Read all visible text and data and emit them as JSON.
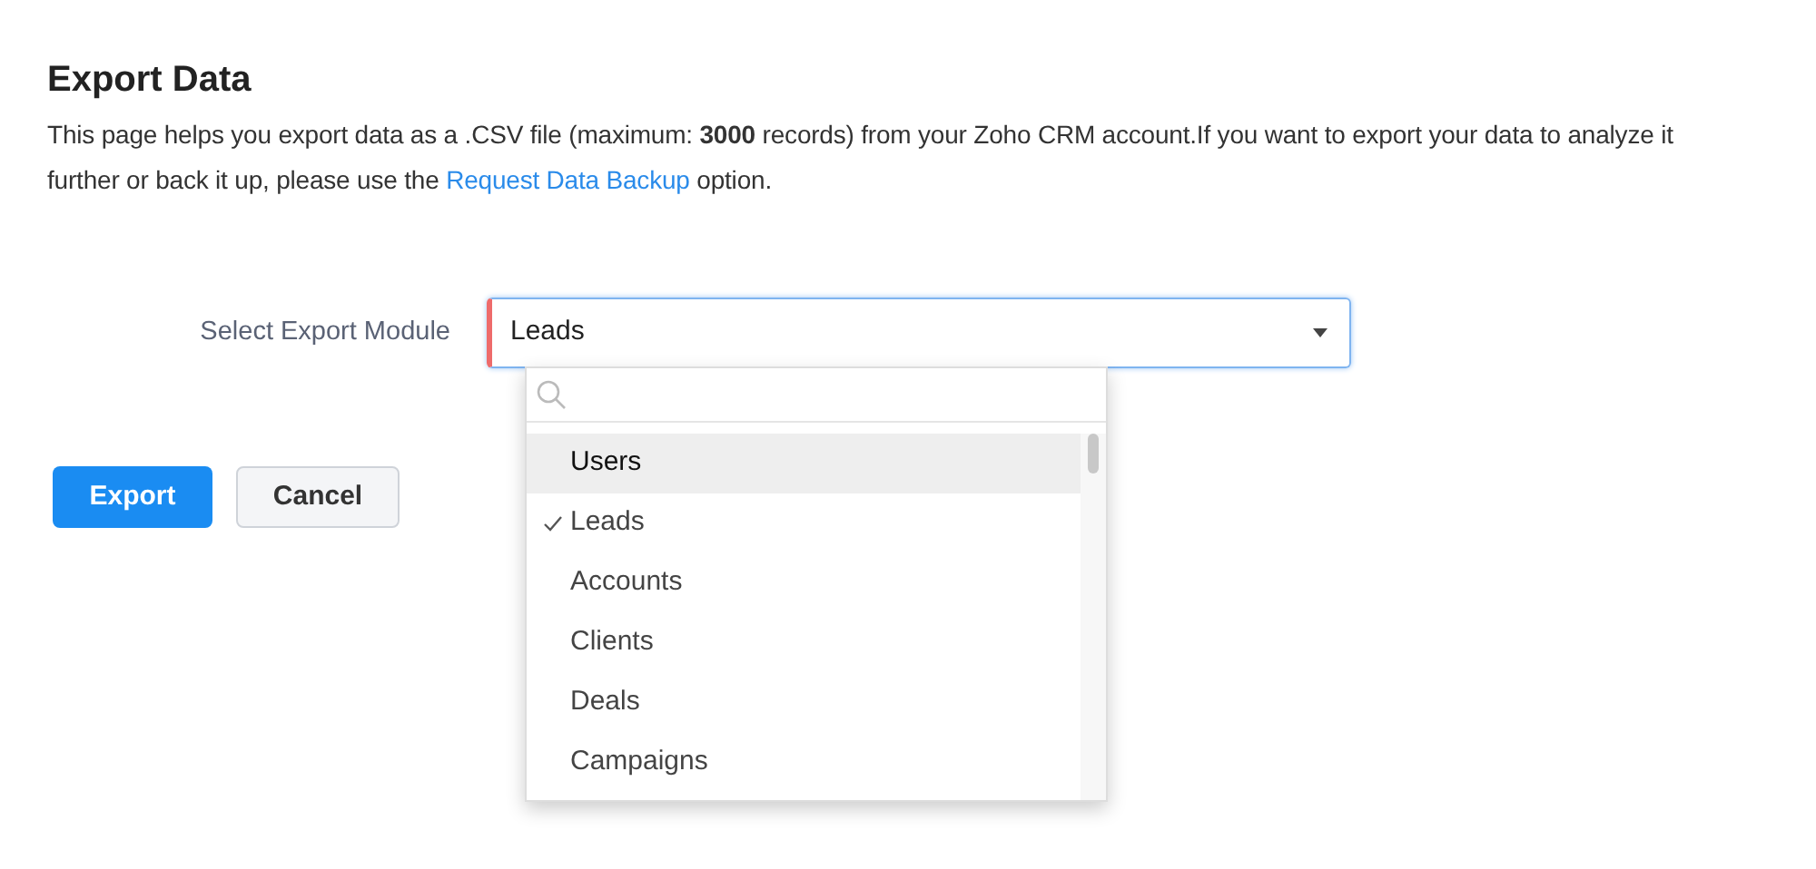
{
  "title": "Export Data",
  "description": {
    "text": "This page helps you export data as a .CSV file (maximum: **3000** records) from your Zoho CRM account.If you want to export your data to analyze it further or back it up, please use the ",
    "link": "Request Data Backup",
    "text_after": " option."
  },
  "module_select": {
    "label": "Select Export Module",
    "value": "Leads",
    "required": true
  },
  "dropdown": {
    "options": [
      {
        "label": "Users",
        "selected": false,
        "highlighted": true
      },
      {
        "label": "Leads",
        "selected": true,
        "highlighted": false
      },
      {
        "label": "Accounts",
        "selected": false,
        "highlighted": false
      },
      {
        "label": "Clients",
        "selected": false,
        "highlighted": false
      },
      {
        "label": "Deals",
        "selected": false,
        "highlighted": false
      },
      {
        "label": "Campaigns",
        "selected": false,
        "highlighted": false
      }
    ]
  },
  "buttons": [
    {
      "label": "Export",
      "kind": "primary"
    },
    {
      "label": "Cancel",
      "kind": "secondary"
    }
  ]
}
